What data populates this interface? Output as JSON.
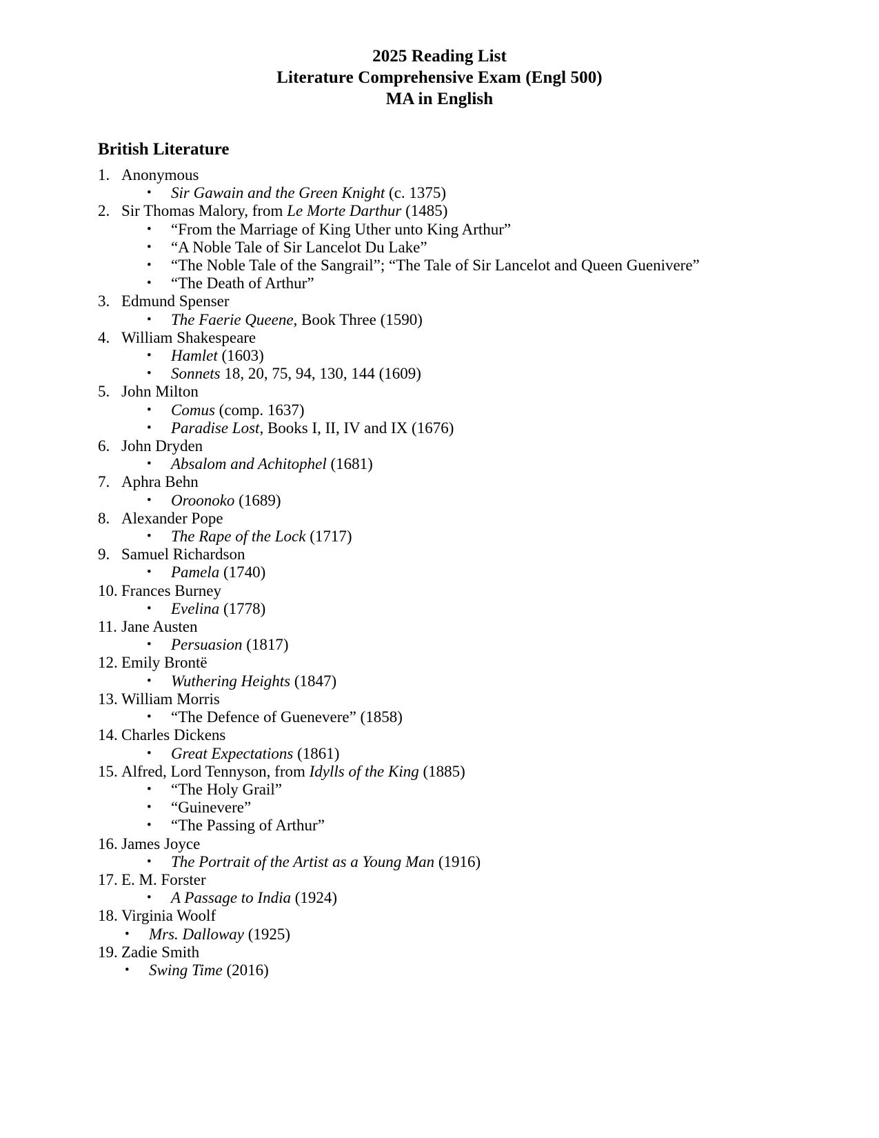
{
  "document": {
    "title_lines": [
      "2025 Reading List",
      "Literature Comprehensive Exam (Engl 500)",
      "MA in English"
    ],
    "bullet_glyph": "•"
  },
  "section": {
    "heading": "British Literature"
  },
  "entries": [
    {
      "number": "1.",
      "author": "Anonymous",
      "works": [
        {
          "italic": "Sir Gawain and the Green Knight",
          "plain": " (c. 1375)"
        }
      ]
    },
    {
      "number": "2.",
      "author_plain_before": "Sir Thomas Malory, from ",
      "author_italic": "Le Morte Darthur",
      "author_plain_after": " (1485)",
      "works": [
        {
          "plain": "“From the Marriage of King Uther unto King Arthur”"
        },
        {
          "plain": "“A Noble Tale of Sir Lancelot Du Lake”"
        },
        {
          "plain": "“The Noble Tale of the Sangrail”; “The Tale of Sir Lancelot and Queen Guenivere”"
        },
        {
          "plain": "“The Death of Arthur”"
        }
      ]
    },
    {
      "number": "3.",
      "author": "Edmund Spenser",
      "works": [
        {
          "italic": "The Faerie Queene",
          "plain": ", Book Three (1590)"
        }
      ]
    },
    {
      "number": "4.",
      "author": "William Shakespeare",
      "works": [
        {
          "italic": "Hamlet",
          "plain": " (1603)"
        },
        {
          "italic": "Sonnets",
          "plain": " 18, 20, 75, 94, 130, 144 (1609)"
        }
      ]
    },
    {
      "number": "5.",
      "author": "John Milton",
      "works": [
        {
          "italic": "Comus",
          "plain": " (comp. 1637)"
        },
        {
          "italic": "Paradise Lost",
          "plain": ", Books I, II, IV and IX (1676)"
        }
      ]
    },
    {
      "number": "6.",
      "author": "John Dryden",
      "works": [
        {
          "italic": "Absalom and Achitophel",
          "plain": " (1681)"
        }
      ]
    },
    {
      "number": "7.",
      "author": "Aphra Behn",
      "works": [
        {
          "italic": "Oroonoko",
          "plain": " (1689)"
        }
      ]
    },
    {
      "number": "8.",
      "author": "Alexander Pope",
      "works": [
        {
          "italic": "The Rape of the Lock",
          "plain": " (1717)"
        }
      ]
    },
    {
      "number": "9.",
      "author": "Samuel Richardson",
      "works": [
        {
          "italic": "Pamela",
          "plain": " (1740)"
        }
      ]
    },
    {
      "number": "10.",
      "author": "Frances Burney",
      "works": [
        {
          "italic": "Evelina",
          "plain": " (1778)"
        }
      ]
    },
    {
      "number": "11.",
      "author": "Jane Austen",
      "works": [
        {
          "italic": "Persuasion",
          "plain": " (1817)"
        }
      ]
    },
    {
      "number": "12.",
      "author": "Emily Brontë",
      "works": [
        {
          "italic": "Wuthering Heights",
          "plain": " (1847)"
        }
      ]
    },
    {
      "number": "13.",
      "author": "William Morris",
      "works": [
        {
          "plain": "“The Defence of Guenevere” (1858)"
        }
      ]
    },
    {
      "number": "14.",
      "author": "Charles Dickens",
      "works": [
        {
          "italic": "Great Expectations",
          "plain": " (1861)"
        }
      ]
    },
    {
      "number": "15.",
      "author_plain_before": "Alfred, Lord Tennyson, from ",
      "author_italic": "Idylls of the King",
      "author_plain_after": " (1885)",
      "works": [
        {
          "plain": "“The Holy Grail”"
        },
        {
          "plain": "“Guinevere”"
        },
        {
          "plain": "“The Passing of Arthur”"
        }
      ]
    },
    {
      "number": "16.",
      "author": "James Joyce",
      "works": [
        {
          "italic": "The Portrait of the Artist as a Young Man",
          "plain": " (1916)"
        }
      ]
    },
    {
      "number": "17.",
      "author": "E. M. Forster",
      "works": [
        {
          "italic": "A Passage to India",
          "plain": " (1924)"
        }
      ]
    },
    {
      "number": "18.",
      "author": "Virginia Woolf",
      "works": [
        {
          "italic": "Mrs. Dalloway",
          "plain": " (1925)",
          "shallow": true
        }
      ]
    },
    {
      "number": "19.",
      "author": "Zadie Smith",
      "works": [
        {
          "italic": "Swing Time",
          "plain": " (2016)",
          "shallow": true
        }
      ]
    }
  ]
}
